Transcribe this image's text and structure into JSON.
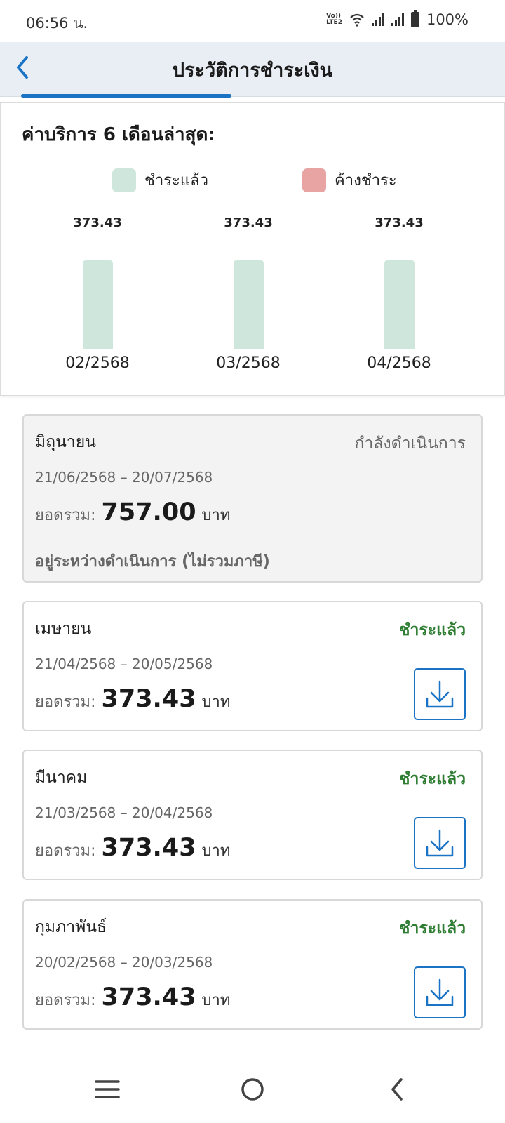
{
  "status_bar": {
    "time": "06:56 น.",
    "volte_line1": "Vo))",
    "volte_line2": "LTE2",
    "battery": "100%"
  },
  "header": {
    "title": "ประวัติการชำระเงิน"
  },
  "chart_card": {
    "title": "ค่าบริการ 6 เดือนล่าสุด:",
    "legend": {
      "paid": "ชำระแล้ว",
      "overdue": "ค้างชำระ"
    }
  },
  "chart_data": {
    "type": "bar",
    "title": "ค่าบริการ 6 เดือนล่าสุด:",
    "categories": [
      "02/2568",
      "03/2568",
      "04/2568"
    ],
    "series": [
      {
        "name": "ชำระแล้ว",
        "values": [
          373.43,
          373.43,
          373.43
        ]
      }
    ],
    "value_labels": [
      "373.43",
      "373.43",
      "373.43"
    ],
    "legend": [
      "ชำระแล้ว",
      "ค้างชำระ"
    ],
    "colors": {
      "paid": "#cfe6dd",
      "overdue": "#e8a3a3"
    }
  },
  "bills": [
    {
      "month": "มิถุนายน",
      "status": "กำลังดำเนินการ",
      "period": "21/06/2568 – 20/07/2568",
      "total_label": "ยอดรวม:",
      "amount": "757.00",
      "unit": "บาท",
      "note": "อยู่ระหว่างดำเนินการ (ไม่รวมภาษี)"
    },
    {
      "month": "เมษายน",
      "status": "ชำระแล้ว",
      "period": "21/04/2568 – 20/05/2568",
      "total_label": "ยอดรวม:",
      "amount": "373.43",
      "unit": "บาท"
    },
    {
      "month": "มีนาคม",
      "status": "ชำระแล้ว",
      "period": "21/03/2568 – 20/04/2568",
      "total_label": "ยอดรวม:",
      "amount": "373.43",
      "unit": "บาท"
    },
    {
      "month": "กุมภาพันธ์",
      "status": "ชำระแล้ว",
      "period": "20/02/2568 – 20/03/2568",
      "total_label": "ยอดรวม:",
      "amount": "373.43",
      "unit": "บาท"
    }
  ],
  "colors": {
    "accent": "#1a73c4",
    "paid_status": "#2e7d32",
    "pending_status": "#666666"
  },
  "icons": {
    "back": "chevron-left-icon",
    "download": "download-icon",
    "nav_recent": "menu-icon",
    "nav_home": "home-circle-icon",
    "nav_back": "back-icon"
  }
}
